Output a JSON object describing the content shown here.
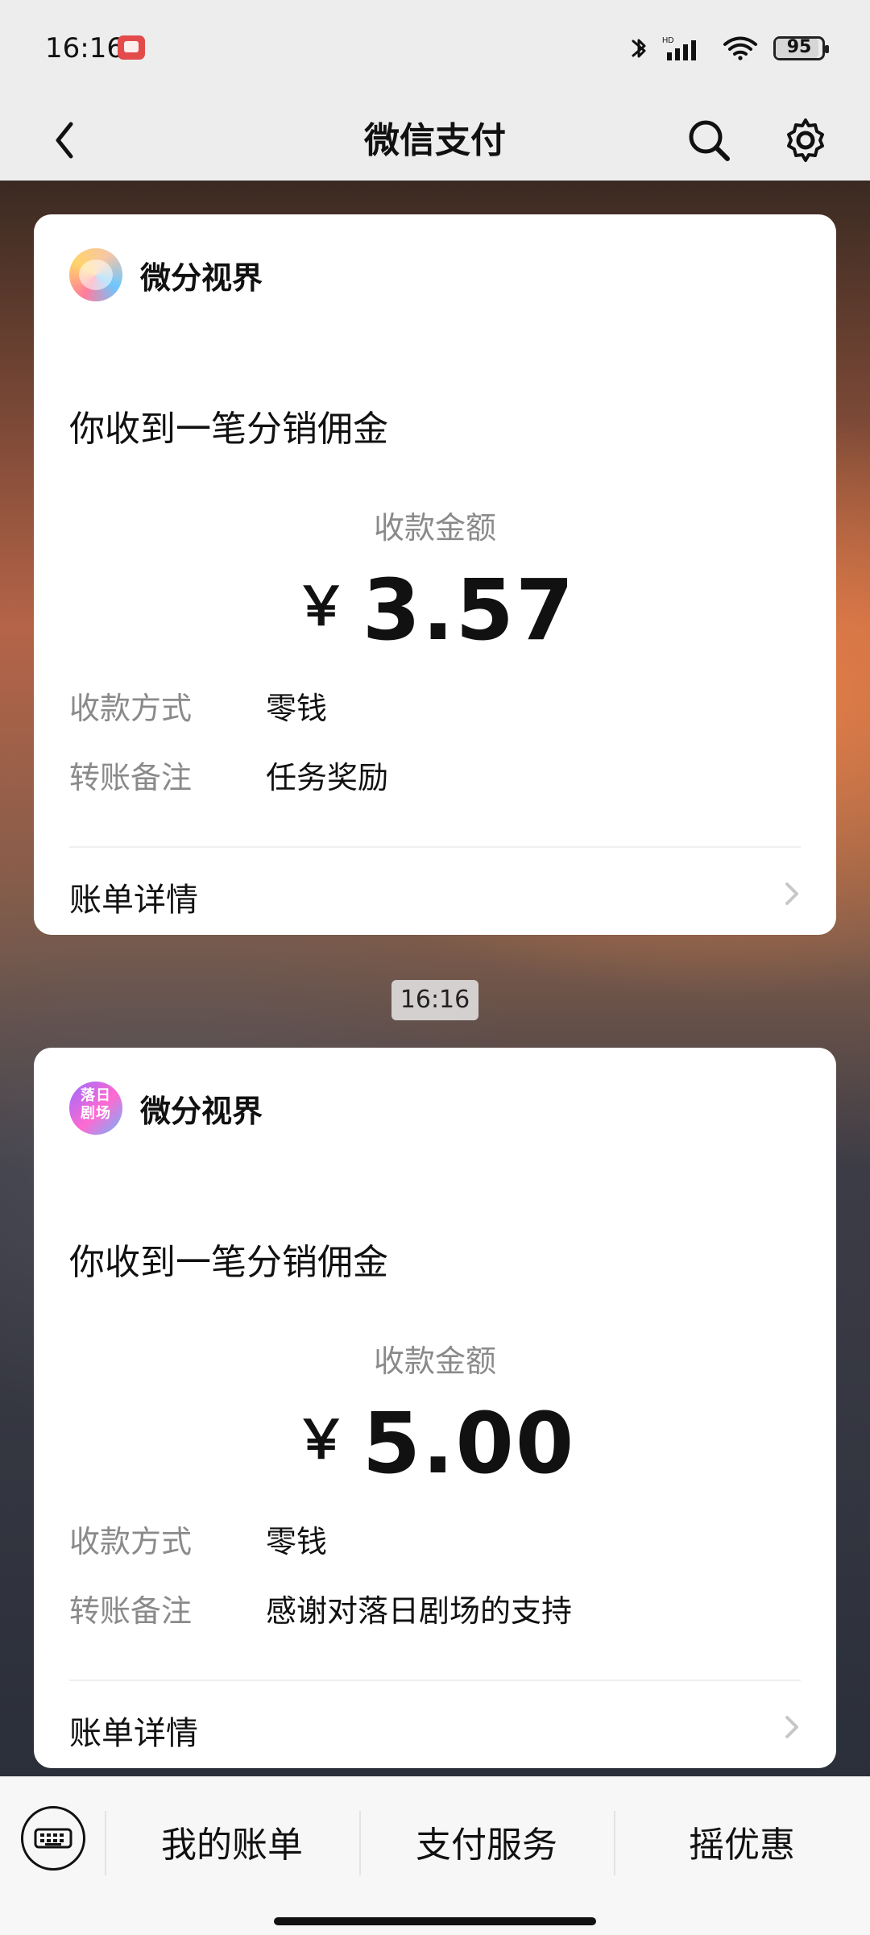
{
  "status_bar": {
    "time": "16:16",
    "battery": "95",
    "icons": [
      "app-notification-icon",
      "bluetooth-icon",
      "signal-icon",
      "wifi-icon",
      "battery-icon"
    ]
  },
  "app_bar": {
    "title": "微信支付",
    "icons": {
      "back": "back-arrow-icon",
      "search": "search-icon",
      "settings": "settings-gear-icon"
    }
  },
  "messages": [
    {
      "merchant": "微分视界",
      "headline": "你收到一笔分销佣金",
      "amount_label": "收款金额",
      "currency": "￥",
      "amount": "3.57",
      "fields": [
        {
          "key": "收款方式",
          "value": "零钱"
        },
        {
          "key": "转账备注",
          "value": "任务奖励"
        }
      ],
      "bill_details": "账单详情"
    },
    {
      "merchant": "微分视界",
      "avatar_text": [
        "落日",
        "剧场"
      ],
      "headline": "你收到一笔分销佣金",
      "amount_label": "收款金额",
      "currency": "￥",
      "amount": "5.00",
      "fields": [
        {
          "key": "收款方式",
          "value": "零钱"
        },
        {
          "key": "转账备注",
          "value": "感谢对落日剧场的支持"
        }
      ],
      "bill_details": "账单详情"
    }
  ],
  "timestamp_between": "16:16",
  "bottom_menu": {
    "items": [
      "我的账单",
      "支付服务",
      "摇优惠"
    ],
    "icons": {
      "keyboard": "keyboard-toggle-icon"
    }
  },
  "colors": {
    "surface": "#ffffff",
    "page_bg": "#ededed",
    "secondary_text": "#8a8a8a",
    "primary_text": "#111111"
  }
}
